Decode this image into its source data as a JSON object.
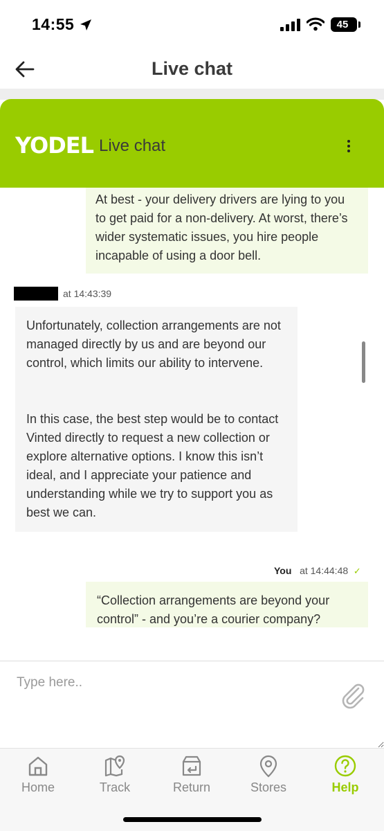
{
  "status": {
    "time": "14:55",
    "battery": "45"
  },
  "header": {
    "title": "Live chat"
  },
  "chat": {
    "brand": "YODEL",
    "title": "Live chat"
  },
  "messages": [
    {
      "sender": "user",
      "text": "At best - your delivery drivers are lying to you to get paid for a non-delivery. At worst, there’s wider systematic issues, you hire people incapable of using a door bell."
    },
    {
      "sender": "agent",
      "meta": "at 14:43:39",
      "paragraphs": [
        "Unfortunately, collection arrangements are not managed directly by us and are beyond our control, which limits our ability to intervene.",
        "In this case, the best step would be to contact Vinted directly to request a new collection or explore alternative options. I know this isn’t ideal, and I appreciate your patience and understanding while we try to support you as best we can."
      ]
    },
    {
      "sender": "user",
      "name": "You",
      "meta": "at 14:44:48",
      "status": "✓",
      "text": "“Collection arrangements are beyond your control” - and you’re a courier company?"
    }
  ],
  "compose": {
    "placeholder": "Type here.."
  },
  "tabs": [
    {
      "label": "Home",
      "icon": "home-icon"
    },
    {
      "label": "Track",
      "icon": "map-pin-icon"
    },
    {
      "label": "Return",
      "icon": "return-box-icon"
    },
    {
      "label": "Stores",
      "icon": "location-icon"
    },
    {
      "label": "Help",
      "icon": "help-icon",
      "active": true
    }
  ],
  "colors": {
    "brand": "#99cc00",
    "user_bubble": "#f4fae6",
    "agent_bubble": "#f5f5f5"
  }
}
